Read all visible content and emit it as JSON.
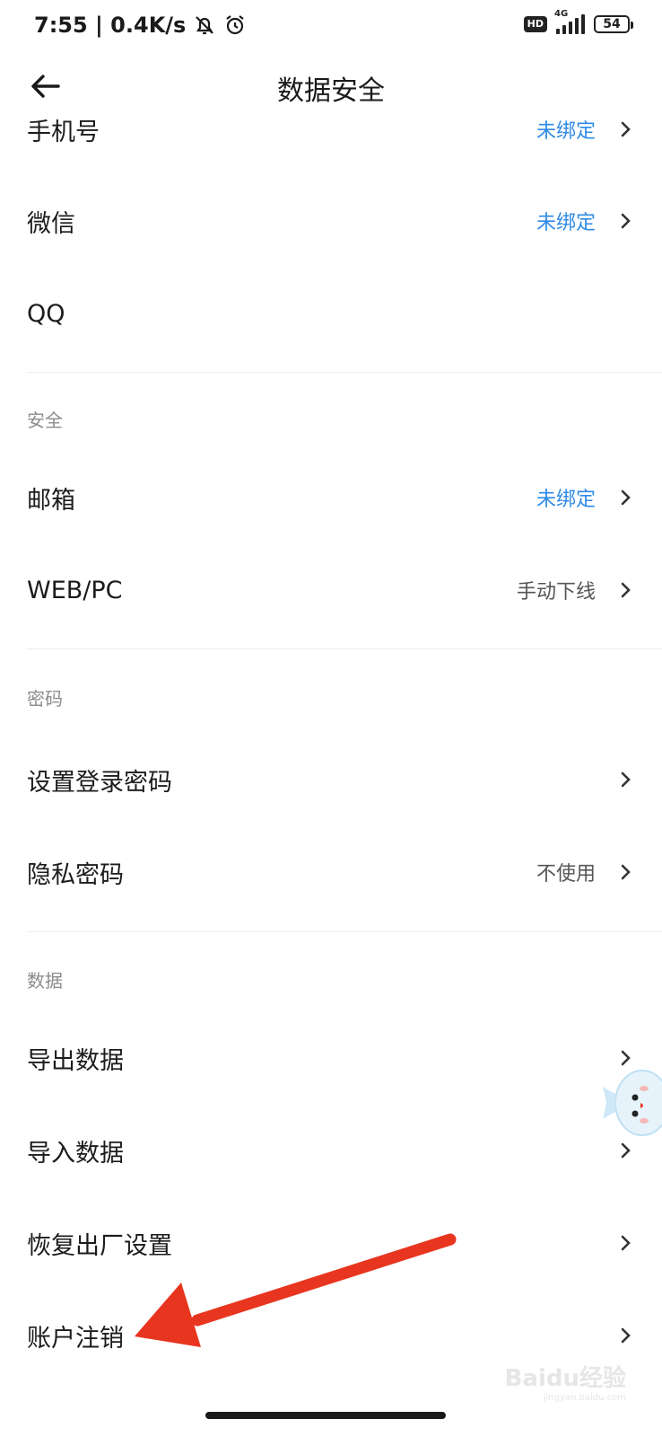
{
  "status_bar": {
    "time_speed": "7:55 | 0.4K/s",
    "hd": "HD",
    "network": "4G",
    "battery": "54"
  },
  "header": {
    "title": "数据安全"
  },
  "account": {
    "phone": {
      "label": "手机号",
      "value": "未绑定"
    },
    "wechat": {
      "label": "微信",
      "value": "未绑定"
    },
    "qq": {
      "label": "QQ"
    }
  },
  "security": {
    "section_title": "安全",
    "email": {
      "label": "邮箱",
      "value": "未绑定"
    },
    "webpc": {
      "label": "WEB/PC",
      "value": "手动下线"
    }
  },
  "password": {
    "section_title": "密码",
    "login_password": {
      "label": "设置登录密码"
    },
    "privacy_password": {
      "label": "隐私密码",
      "value": "不使用"
    }
  },
  "data": {
    "section_title": "数据",
    "export": {
      "label": "导出数据"
    },
    "import": {
      "label": "导入数据"
    },
    "factory_reset": {
      "label": "恢复出厂设置"
    },
    "delete_account": {
      "label": "账户注销"
    }
  },
  "watermark": {
    "brand": "Baidu经验",
    "url": "jingyan.baidu.com"
  },
  "colors": {
    "link_blue": "#2e8ae6",
    "arrow_red": "#e8351f"
  }
}
